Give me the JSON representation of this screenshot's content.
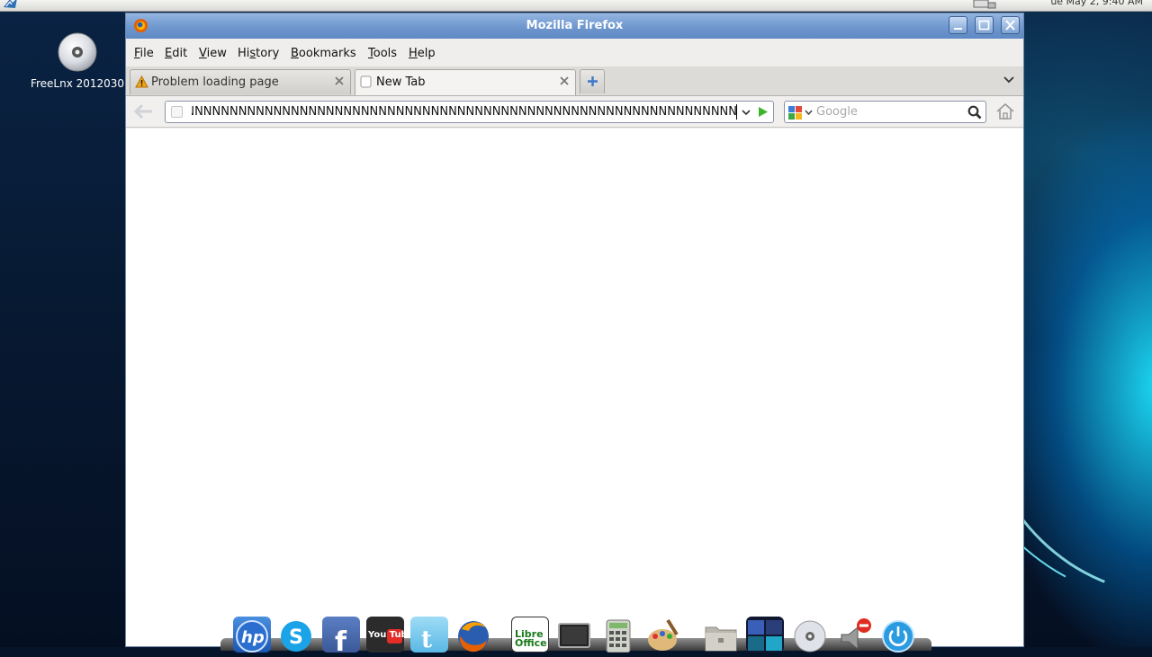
{
  "desktop": {
    "icon_label": "FreeLnx 2012030",
    "clock": "ue May  2,  9:40 AM"
  },
  "window": {
    "title": "Mozilla Firefox"
  },
  "menubar": {
    "items": [
      {
        "prefix": "",
        "key": "F",
        "rest": "ile"
      },
      {
        "prefix": "",
        "key": "E",
        "rest": "dit"
      },
      {
        "prefix": "",
        "key": "V",
        "rest": "iew"
      },
      {
        "prefix": "Hi",
        "key": "s",
        "rest": "tory"
      },
      {
        "prefix": "",
        "key": "B",
        "rest": "ookmarks"
      },
      {
        "prefix": "",
        "key": "T",
        "rest": "ools"
      },
      {
        "prefix": "",
        "key": "H",
        "rest": "elp"
      }
    ]
  },
  "tabs": [
    {
      "label": "Problem  loading  page",
      "icon": "warning-icon"
    },
    {
      "label": "New  Tab",
      "icon": "blank-page-icon"
    }
  ],
  "navbar": {
    "url_value": "NNNNNNNNNNNNNNNNNNNNNNNNNNNNNNNNNNNNNNNNNNNNNNNNNNNNNNNNNNNNNNNNNNNNNNNNNNNNNNNNNNNNNNNNN",
    "search_placeholder": "Google",
    "search_engine_icon": "google-icon"
  },
  "dock": {
    "icons": [
      "hp-icon",
      "skype-icon",
      "facebook-icon",
      "youtube-icon",
      "twitter-icon",
      "firefox-icon",
      "libreoffice-icon",
      "terminal-icon",
      "calculator-icon",
      "paint-icon",
      "folder-icon",
      "screenshot-icon",
      "cd-icon",
      "volume-muted-icon",
      "power-icon"
    ],
    "youtube_label": "You Tube",
    "libre_label": "Libre Office"
  },
  "colors": {
    "titlebar": "#6e97cf",
    "accent_go": "#3db52a",
    "newtab_plus": "#3f78c8"
  }
}
